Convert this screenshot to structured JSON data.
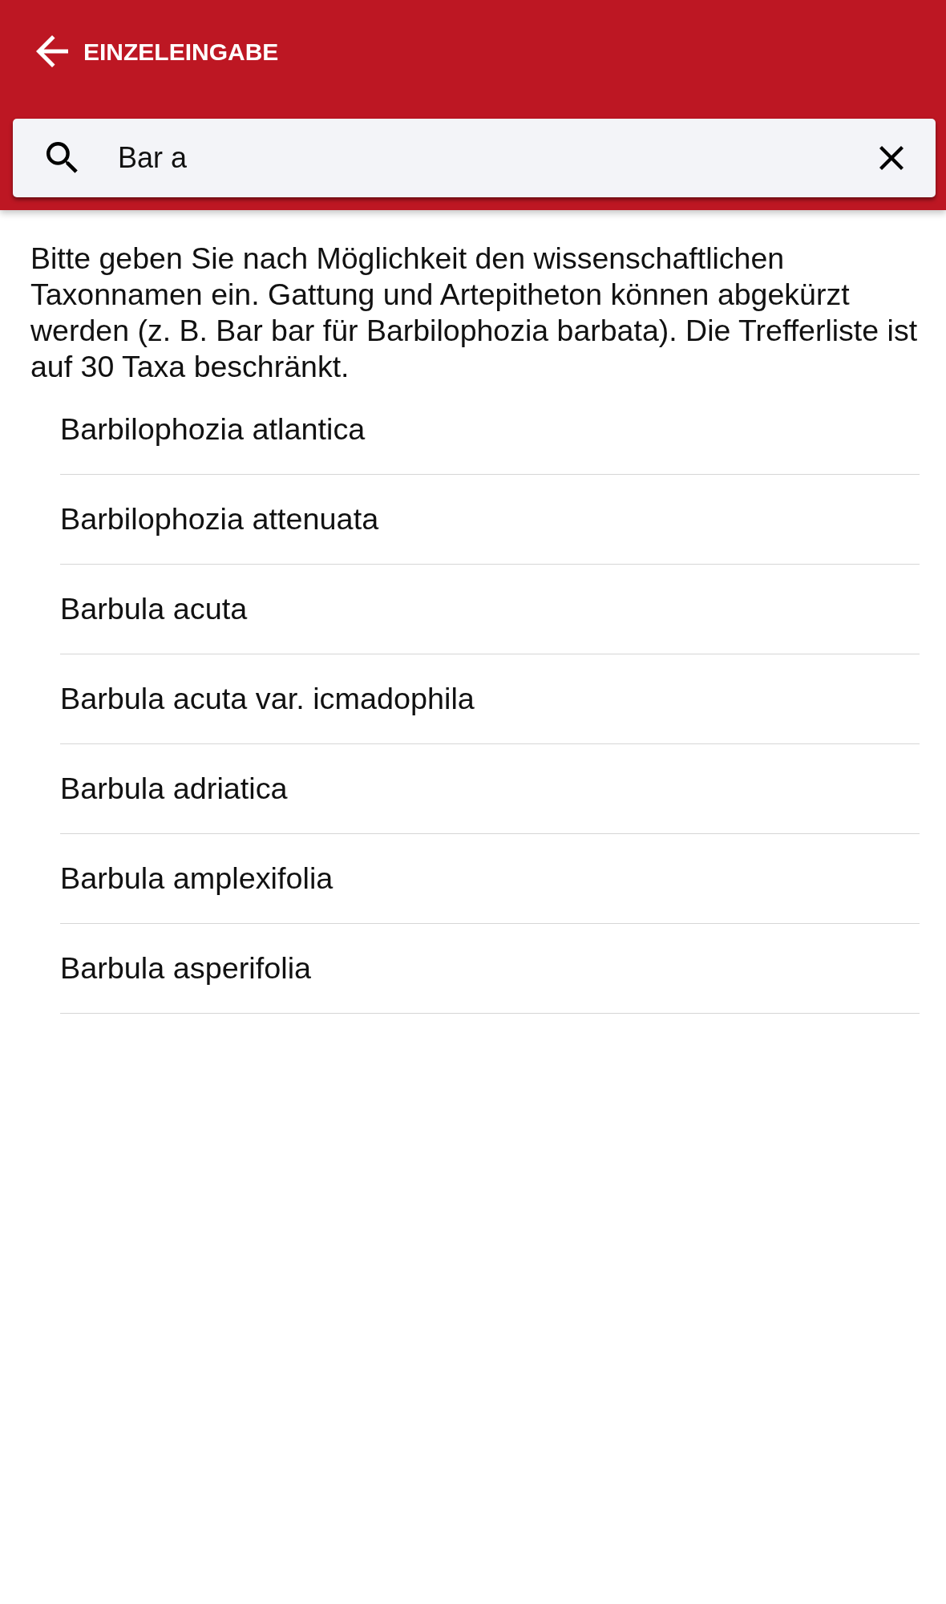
{
  "app_bar": {
    "title": "EINZELEINGABE"
  },
  "search": {
    "value": "Bar a"
  },
  "hint": "Bitte geben Sie nach Möglichkeit den wissenschaftlichen Taxonnamen ein. Gattung und Artepitheton können abgekürzt werden (z. B. Bar bar für Barbilophozia barbata). Die Trefferliste ist auf 30 Taxa beschränkt.",
  "results": [
    "Barbilophozia atlantica",
    "Barbilophozia attenuata",
    "Barbula acuta",
    "Barbula acuta var. icmadophila",
    "Barbula adriatica",
    "Barbula amplexifolia",
    "Barbula asperifolia"
  ]
}
